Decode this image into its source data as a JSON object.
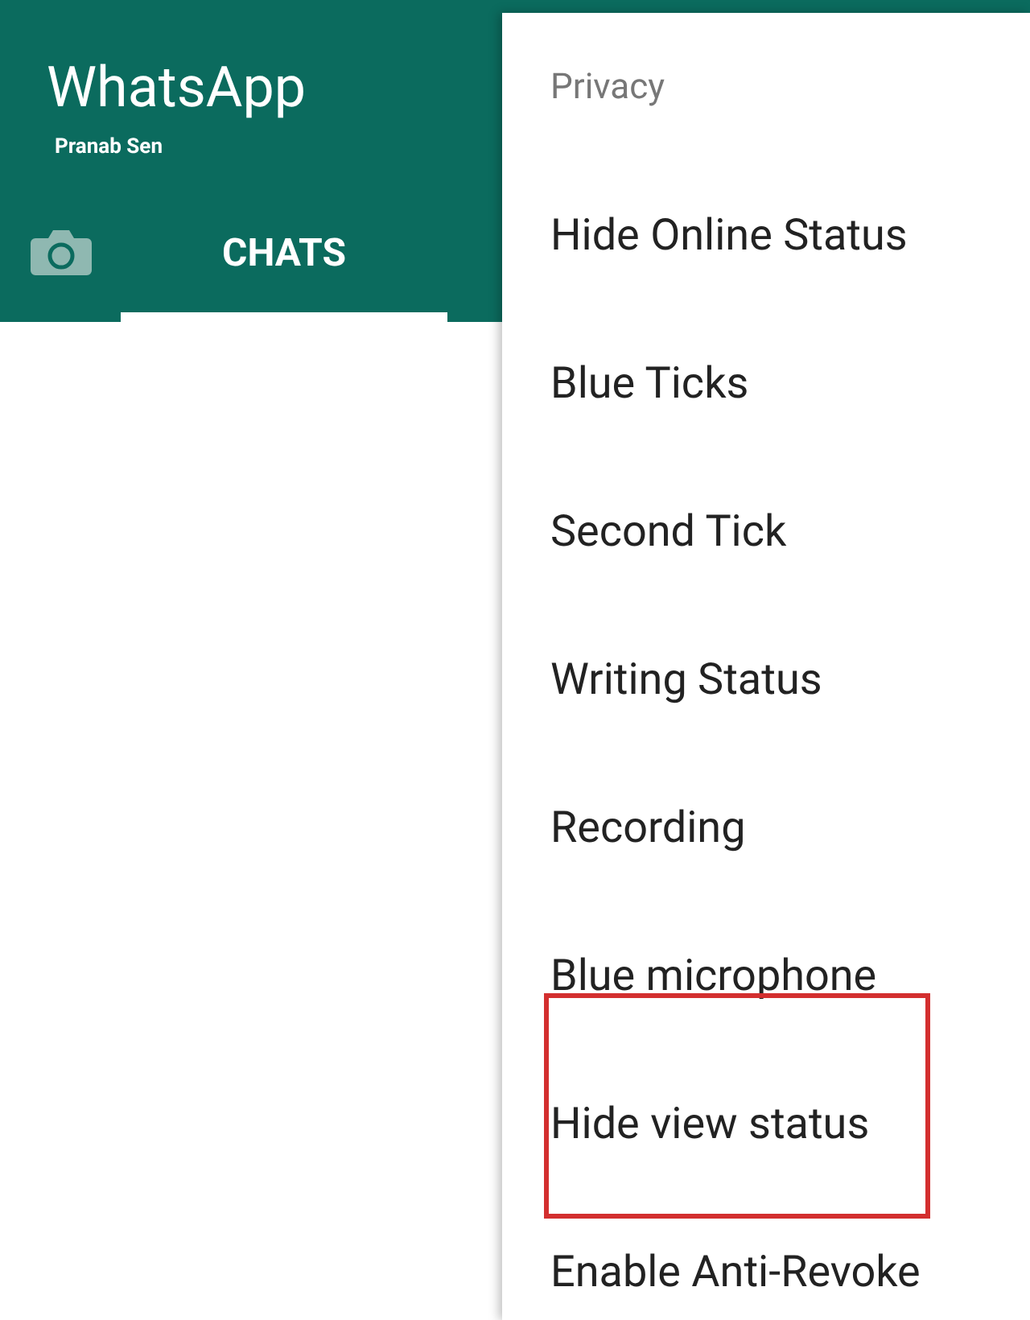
{
  "app_bar": {
    "title": "WhatsApp",
    "subtitle": "Pranab Sen"
  },
  "tabs": [
    {
      "kind": "camera",
      "selected": false
    },
    {
      "kind": "text",
      "label": "CHATS",
      "selected": true
    }
  ],
  "menu": {
    "header": "Privacy",
    "items": [
      {
        "label": "Hide Online Status",
        "highlighted": false
      },
      {
        "label": "Blue Ticks",
        "highlighted": false
      },
      {
        "label": "Second Tick",
        "highlighted": false
      },
      {
        "label": "Writing Status",
        "highlighted": false
      },
      {
        "label": "Recording",
        "highlighted": false
      },
      {
        "label": "Blue microphone",
        "highlighted": false
      },
      {
        "label": "Hide view status",
        "highlighted": true
      },
      {
        "label": "Enable Anti-Revoke",
        "highlighted": false
      }
    ]
  }
}
